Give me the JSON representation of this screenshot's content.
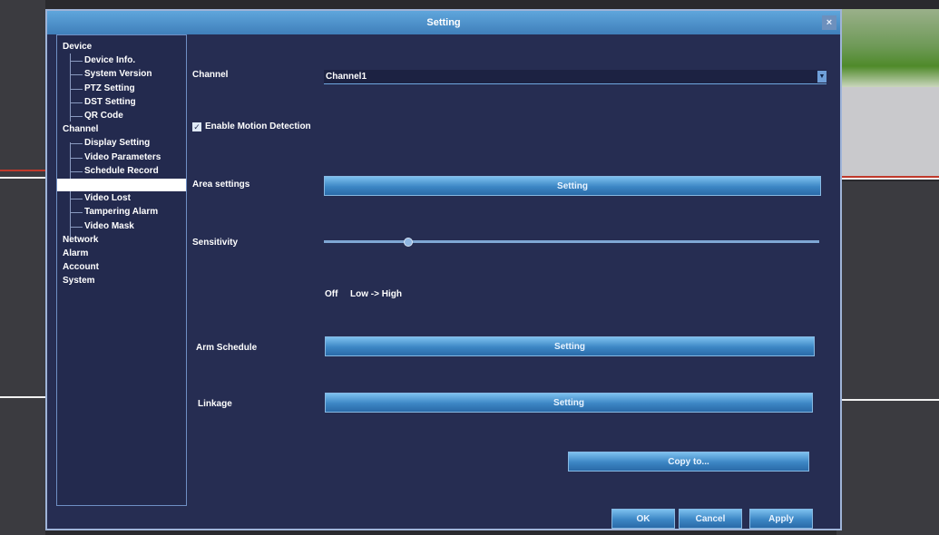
{
  "dialog": {
    "title": "Setting",
    "close_symbol": "×"
  },
  "sidebar": {
    "items": [
      {
        "label": "Device",
        "level": 0
      },
      {
        "label": "Device Info.",
        "level": 1
      },
      {
        "label": "System Version",
        "level": 1
      },
      {
        "label": "PTZ Setting",
        "level": 1
      },
      {
        "label": "DST Setting",
        "level": 1
      },
      {
        "label": "QR Code",
        "level": 1
      },
      {
        "label": "Channel",
        "level": 0
      },
      {
        "label": "Display Setting",
        "level": 1
      },
      {
        "label": "Video Parameters",
        "level": 1
      },
      {
        "label": "Schedule Record",
        "level": 1
      },
      {
        "label": "",
        "level": 1,
        "selected": true
      },
      {
        "label": "Video Lost",
        "level": 1
      },
      {
        "label": "Tampering Alarm",
        "level": 1
      },
      {
        "label": "Video Mask",
        "level": 1
      },
      {
        "label": "Network",
        "level": 0
      },
      {
        "label": "Alarm",
        "level": 0
      },
      {
        "label": "Account",
        "level": 0
      },
      {
        "label": "System",
        "level": 0
      }
    ]
  },
  "form": {
    "channel_label": "Channel",
    "channel_value": "Channel1",
    "enable_motion_label": "Enable Motion Detection",
    "enable_motion_checked": true,
    "area_label": "Area settings",
    "area_button": "Setting",
    "sensitivity_label": "Sensitivity",
    "sensitivity_fraction": 0.17,
    "sensitivity_off": "Off",
    "sensitivity_range": "Low -> High",
    "arm_schedule_label": "Arm Schedule",
    "arm_schedule_button": "Setting",
    "linkage_label": "Linkage",
    "linkage_button": "Setting",
    "copy_button": "Copy to..."
  },
  "footer": {
    "ok": "OK",
    "cancel": "Cancel",
    "apply": "Apply"
  },
  "colors": {
    "dialog_bg": "#262d52",
    "button_accent": "#3c86c4",
    "title_bar": "#4f93cc"
  }
}
